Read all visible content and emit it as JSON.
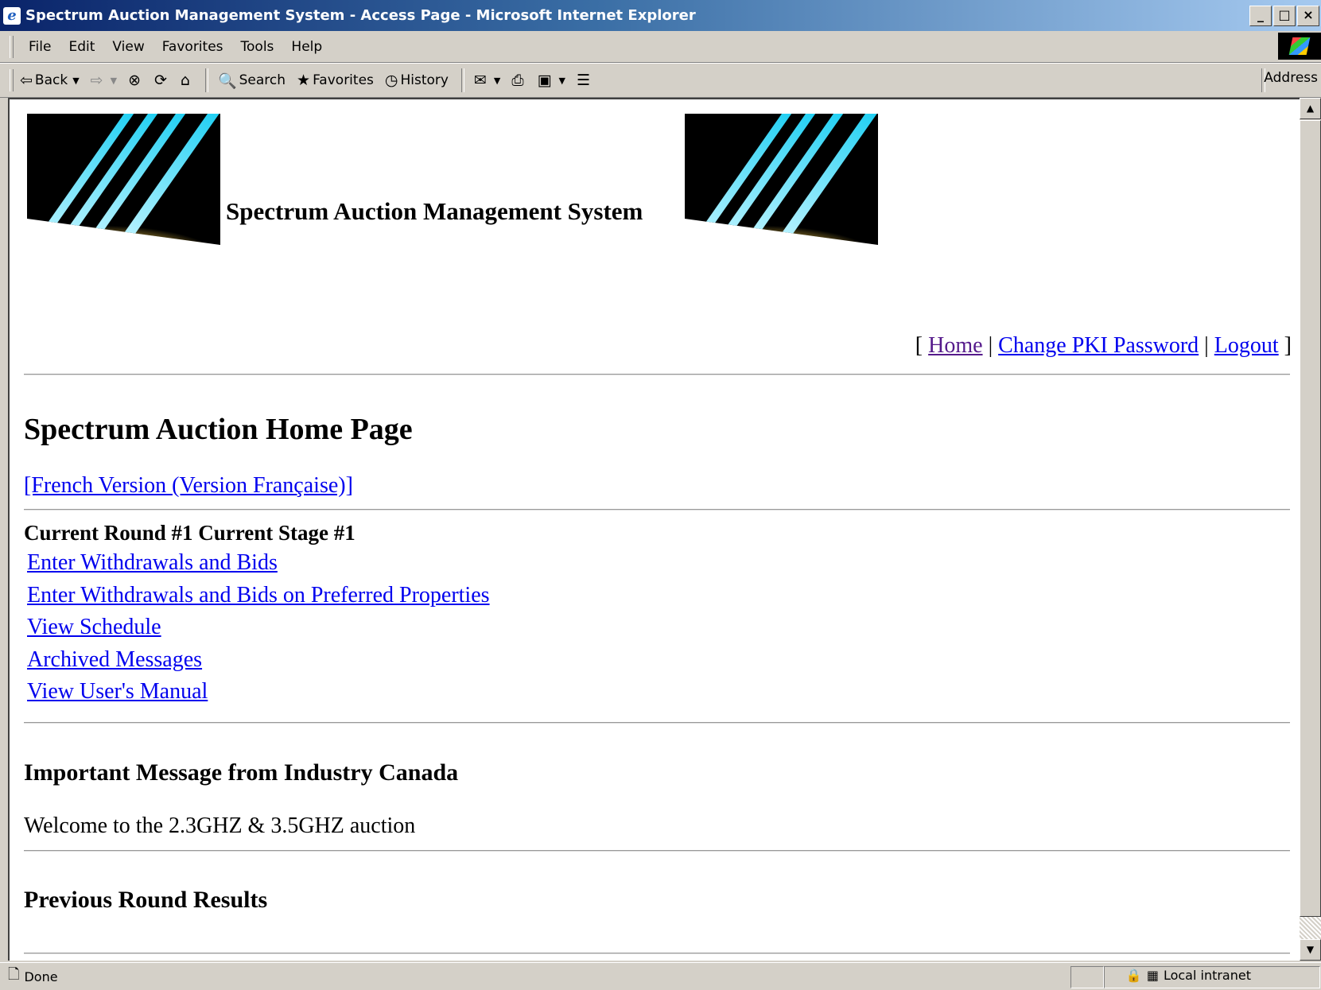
{
  "window": {
    "title": "Spectrum Auction Management System - Access Page - Microsoft Internet Explorer",
    "buttons": [
      "_",
      "□",
      "×"
    ]
  },
  "menubar": {
    "items": [
      {
        "label": "File"
      },
      {
        "label": "Edit"
      },
      {
        "label": "View"
      },
      {
        "label": "Favorites"
      },
      {
        "label": "Tools"
      },
      {
        "label": "Help"
      }
    ]
  },
  "toolbar": {
    "back_label": "Back",
    "search_label": "Search",
    "favorites_label": "Favorites",
    "history_label": "History",
    "address_label": "Address"
  },
  "page": {
    "banner_title": "Spectrum Auction Management System",
    "nav": {
      "home": "Home",
      "change_password": "Change PKI Password",
      "logout": "Logout"
    },
    "heading": "Spectrum Auction Home Page",
    "french_link": "[French Version (Version Française)]",
    "round_status": "Current Round #1 Current Stage #1",
    "links": [
      "Enter Withdrawals and Bids",
      "Enter Withdrawals and Bids on Preferred Properties",
      "View Schedule",
      "Archived Messages",
      "View User's Manual"
    ],
    "message_heading": "Important Message from Industry Canada",
    "message_text": "Welcome to the 2.3GHZ & 3.5GHZ auction",
    "results_heading": "Previous Round Results"
  },
  "statusbar": {
    "status": "Done",
    "zone": "Local intranet"
  }
}
